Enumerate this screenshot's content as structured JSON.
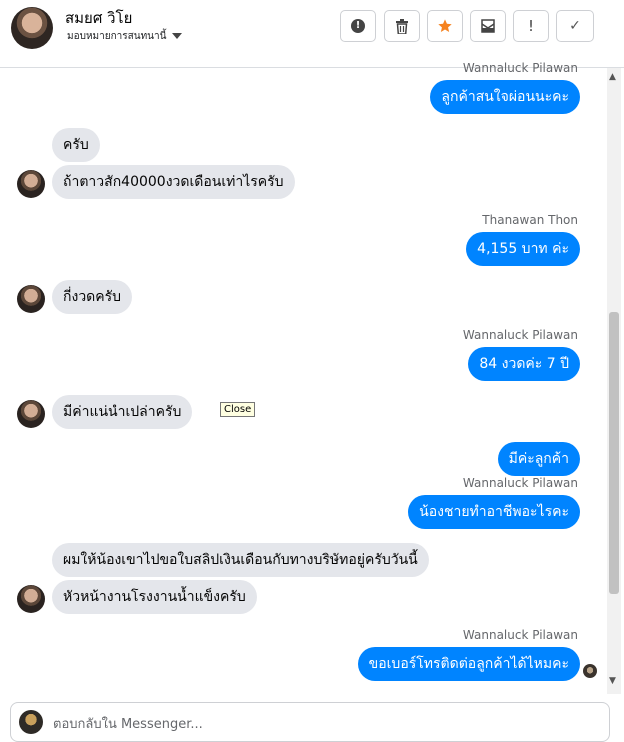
{
  "header": {
    "name": "สมยศ วิโย",
    "subtitle": "มอบหมายการสนทนานี้",
    "buttons": [
      {
        "icon": "alert-circle-icon",
        "glyph": "!"
      },
      {
        "icon": "trash-icon",
        "glyph": "🗑"
      },
      {
        "icon": "star-icon",
        "glyph": "★"
      },
      {
        "icon": "archive-icon",
        "glyph": "⊠"
      },
      {
        "icon": "exclamation-icon",
        "glyph": "!"
      },
      {
        "icon": "check-icon",
        "glyph": "✓"
      }
    ]
  },
  "messages": [
    {
      "dir": "out",
      "sender": "Wannaluck Pilawan",
      "text": "ลูกค้าสนใจผ่อนนะคะ"
    },
    {
      "dir": "in",
      "text": "ครับ"
    },
    {
      "dir": "in",
      "text": "ถ้าตาวสัก40000งวดเดือนเท่าไรครับ"
    },
    {
      "dir": "out",
      "sender": "Thanawan Thon",
      "text": "4,155 บาท ค่ะ"
    },
    {
      "dir": "in",
      "text": "กี่งวดครับ"
    },
    {
      "dir": "out",
      "sender": "Wannaluck Pilawan",
      "text": "84 งวดค่ะ  7 ปี"
    },
    {
      "dir": "in",
      "text": "มีค่าแน่นำเปล่าครับ"
    },
    {
      "dir": "out",
      "text": "มีค่ะลูกค้า"
    },
    {
      "dir": "out",
      "sender": "Wannaluck Pilawan",
      "text": "น้องชายทำอาชีพอะไรคะ"
    },
    {
      "dir": "in",
      "text": "ผมให้น้องเขาไปขอใบสลิปเงินเดือนกับทางบริษัทอยู่ครับวันนี้"
    },
    {
      "dir": "in",
      "text": "หัวหน้างานโรงงานน้ำแข็งครับ"
    },
    {
      "dir": "out",
      "sender": "Wannaluck Pilawan",
      "text": "ขอเบอร์โทรติดต่อลูกค้าได้ไหมคะ"
    }
  ],
  "tooltip": "Close",
  "composer": {
    "placeholder": "ตอบกลับใน Messenger..."
  },
  "colors": {
    "outgoing_bubble": "#0084ff",
    "incoming_bubble": "#e4e6eb",
    "star": "#f5821f"
  }
}
